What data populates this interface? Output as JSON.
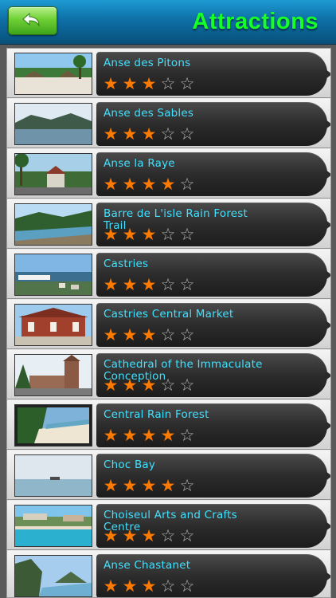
{
  "header": {
    "title": "Attractions",
    "back_icon": "back-arrow-icon",
    "accent_color": "#16ff27"
  },
  "items": [
    {
      "name": "Anse des Pitons",
      "rating": 3,
      "max": 5,
      "thumb": "beach-palms"
    },
    {
      "name": "Anse des Sables",
      "rating": 3,
      "max": 5,
      "thumb": "bay-hills"
    },
    {
      "name": "Anse la Raye",
      "rating": 4,
      "max": 5,
      "thumb": "village-street"
    },
    {
      "name": "Barre de L'isle Rain Forest Trail",
      "rating": 3,
      "max": 5,
      "thumb": "coast-hills"
    },
    {
      "name": "Castries",
      "rating": 3,
      "max": 5,
      "thumb": "harbor-town"
    },
    {
      "name": "Castries Central Market",
      "rating": 3,
      "max": 5,
      "thumb": "market-building"
    },
    {
      "name": "Cathedral of the Immaculate Conception",
      "rating": 3,
      "max": 5,
      "thumb": "cathedral-tower"
    },
    {
      "name": "Central Rain Forest",
      "rating": 4,
      "max": 5,
      "thumb": "forest-beach"
    },
    {
      "name": "Choc Bay",
      "rating": 4,
      "max": 5,
      "thumb": "calm-sea"
    },
    {
      "name": "Choiseul Arts and Crafts Centre",
      "rating": 3,
      "max": 5,
      "thumb": "resort-pool"
    },
    {
      "name": "Anse Chastanet",
      "rating": 3,
      "max": 5,
      "thumb": "rock-coast"
    }
  ],
  "colors": {
    "star_filled": "#ff7a00",
    "star_empty": "#b8b8b8",
    "item_text": "#3fe1ff"
  }
}
